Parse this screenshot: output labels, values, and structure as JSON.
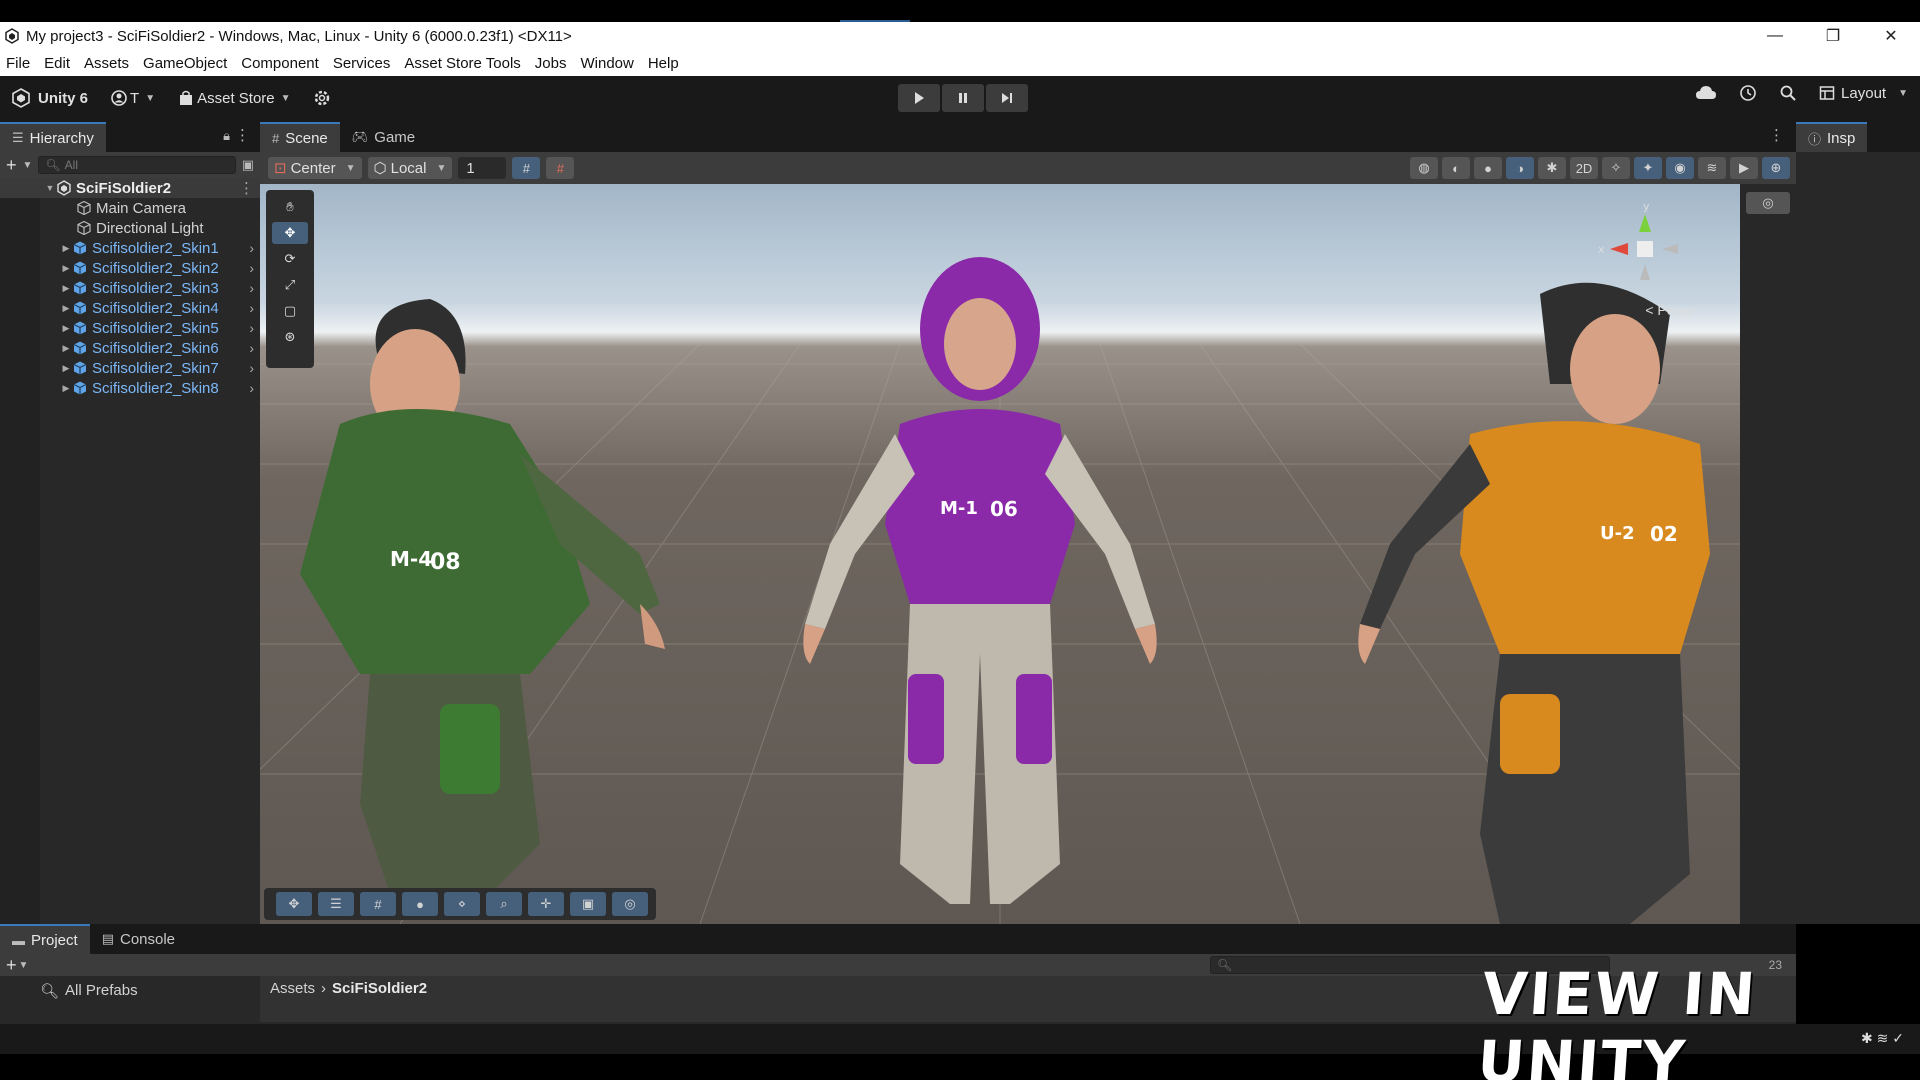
{
  "window": {
    "title": "My project3 - SciFiSoldier2 - Windows, Mac, Linux - Unity 6 (6000.0.23f1) <DX11>",
    "controls": [
      "—",
      "❐",
      "✕"
    ]
  },
  "menu": [
    "File",
    "Edit",
    "Assets",
    "GameObject",
    "Component",
    "Services",
    "Asset Store Tools",
    "Jobs",
    "Window",
    "Help"
  ],
  "toolbar": {
    "unity_label": "Unity 6",
    "account_label": "T",
    "asset_store_label": "Asset Store",
    "layout_label": "Layout"
  },
  "hierarchy": {
    "tab_label": "Hierarchy",
    "search_placeholder": "All",
    "scene_name": "SciFiSoldier2",
    "items": [
      {
        "label": "Main Camera",
        "type": "object"
      },
      {
        "label": "Directional Light",
        "type": "object"
      },
      {
        "label": "Scifisoldier2_Skin1",
        "type": "prefab"
      },
      {
        "label": "Scifisoldier2_Skin2",
        "type": "prefab"
      },
      {
        "label": "Scifisoldier2_Skin3",
        "type": "prefab"
      },
      {
        "label": "Scifisoldier2_Skin4",
        "type": "prefab"
      },
      {
        "label": "Scifisoldier2_Skin5",
        "type": "prefab"
      },
      {
        "label": "Scifisoldier2_Skin6",
        "type": "prefab"
      },
      {
        "label": "Scifisoldier2_Skin7",
        "type": "prefab"
      },
      {
        "label": "Scifisoldier2_Skin8",
        "type": "prefab"
      }
    ]
  },
  "scene": {
    "tabs": [
      "Scene",
      "Game"
    ],
    "pivot_mode": "Center",
    "pivot_rotation": "Local",
    "grid_snap_value": "1",
    "view_label": "< Persp",
    "characters": [
      {
        "armor_color": "#3d7a32",
        "chest_text": "08",
        "tag": "M-4"
      },
      {
        "armor_color": "#8a2aa8",
        "chest_text": "06",
        "tag": "M-1"
      },
      {
        "armor_color": "#d98a1e",
        "chest_text": "02",
        "tag": "U-2"
      }
    ]
  },
  "inspector": {
    "tab_label": "Insp"
  },
  "project": {
    "tabs": [
      "Project",
      "Console"
    ],
    "left_item": "All Prefabs",
    "breadcrumb_root": "Assets",
    "breadcrumb_current": "SciFiSoldier2",
    "count": "23"
  },
  "watermark": "VIEW IN UNITY",
  "colors": {
    "accent": "#3a79bb",
    "prefab_text": "#7cb7f7",
    "panel": "#282828",
    "toolbar": "#191919"
  }
}
